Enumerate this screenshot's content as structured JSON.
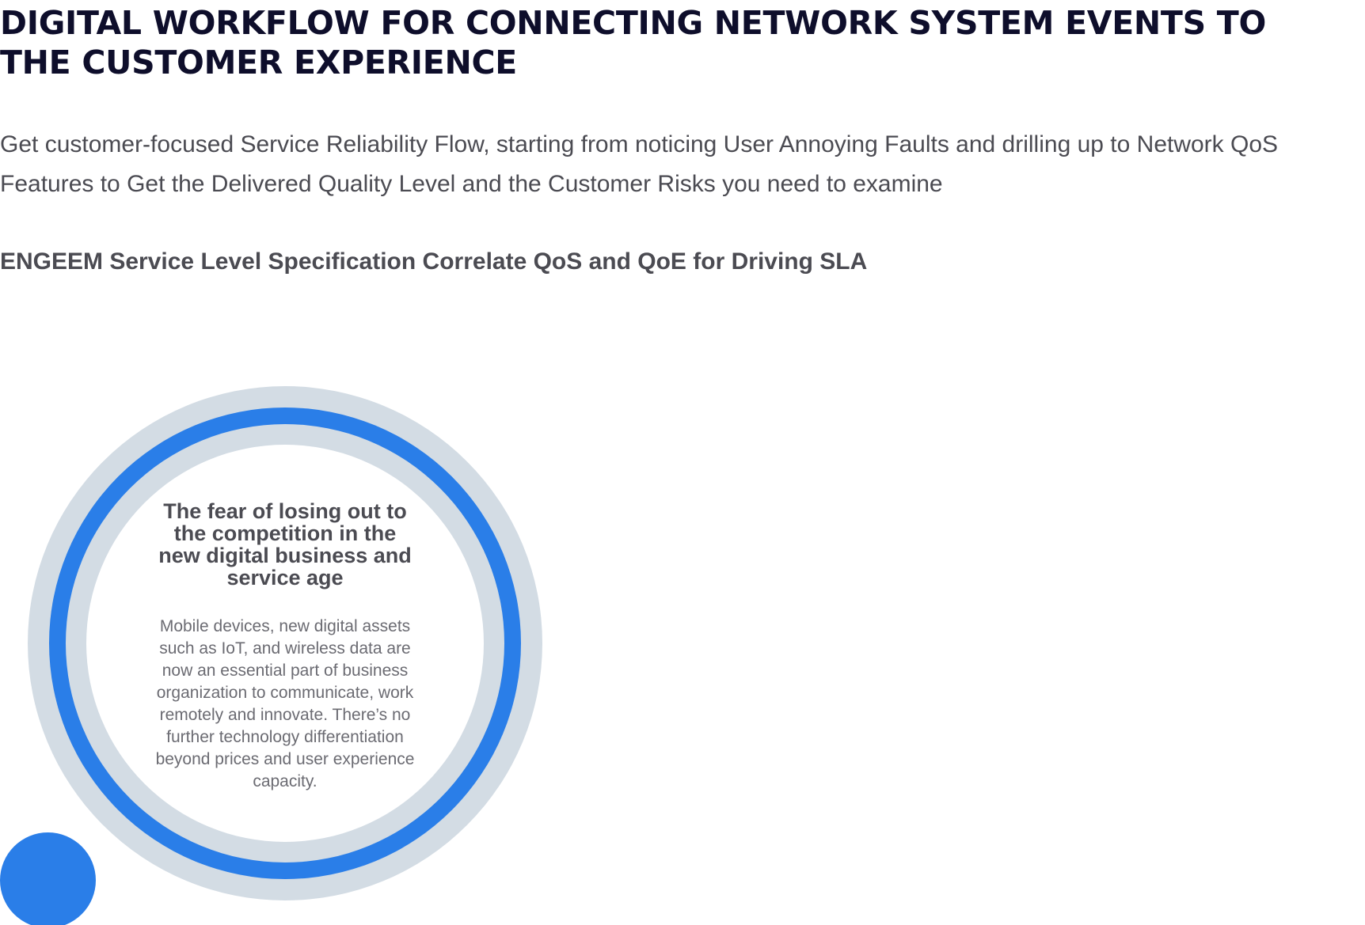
{
  "page": {
    "title": "DIGITAL WORKFLOW FOR CONNECTING NETWORK SYSTEM EVENTS TO THE CUSTOMER EXPERIENCE",
    "intro": "Get customer-focused Service Reliability Flow, starting from noticing User Annoying Faults and drilling up to Network QoS Features to Get the Delivered Quality Level and the Customer Risks you need to examine",
    "section_heading": "ENGEEM Service Level Specification Correlate QoS and QoE for Driving SLA"
  },
  "circle": {
    "heading": "The fear of losing out to the competition in the new digital business and service age",
    "body": "Mobile devices, new digital assets such as IoT, and wireless data are now an essential part of business organization to communicate, work remotely and innovate. There’s no further technology differentiation beyond prices and user experience capacity."
  },
  "colors": {
    "accent_blue": "#2a7ee8",
    "ring_gray": "#d3dce4",
    "title_navy": "#0e0e2b",
    "text_gray": "#4b4b52"
  }
}
